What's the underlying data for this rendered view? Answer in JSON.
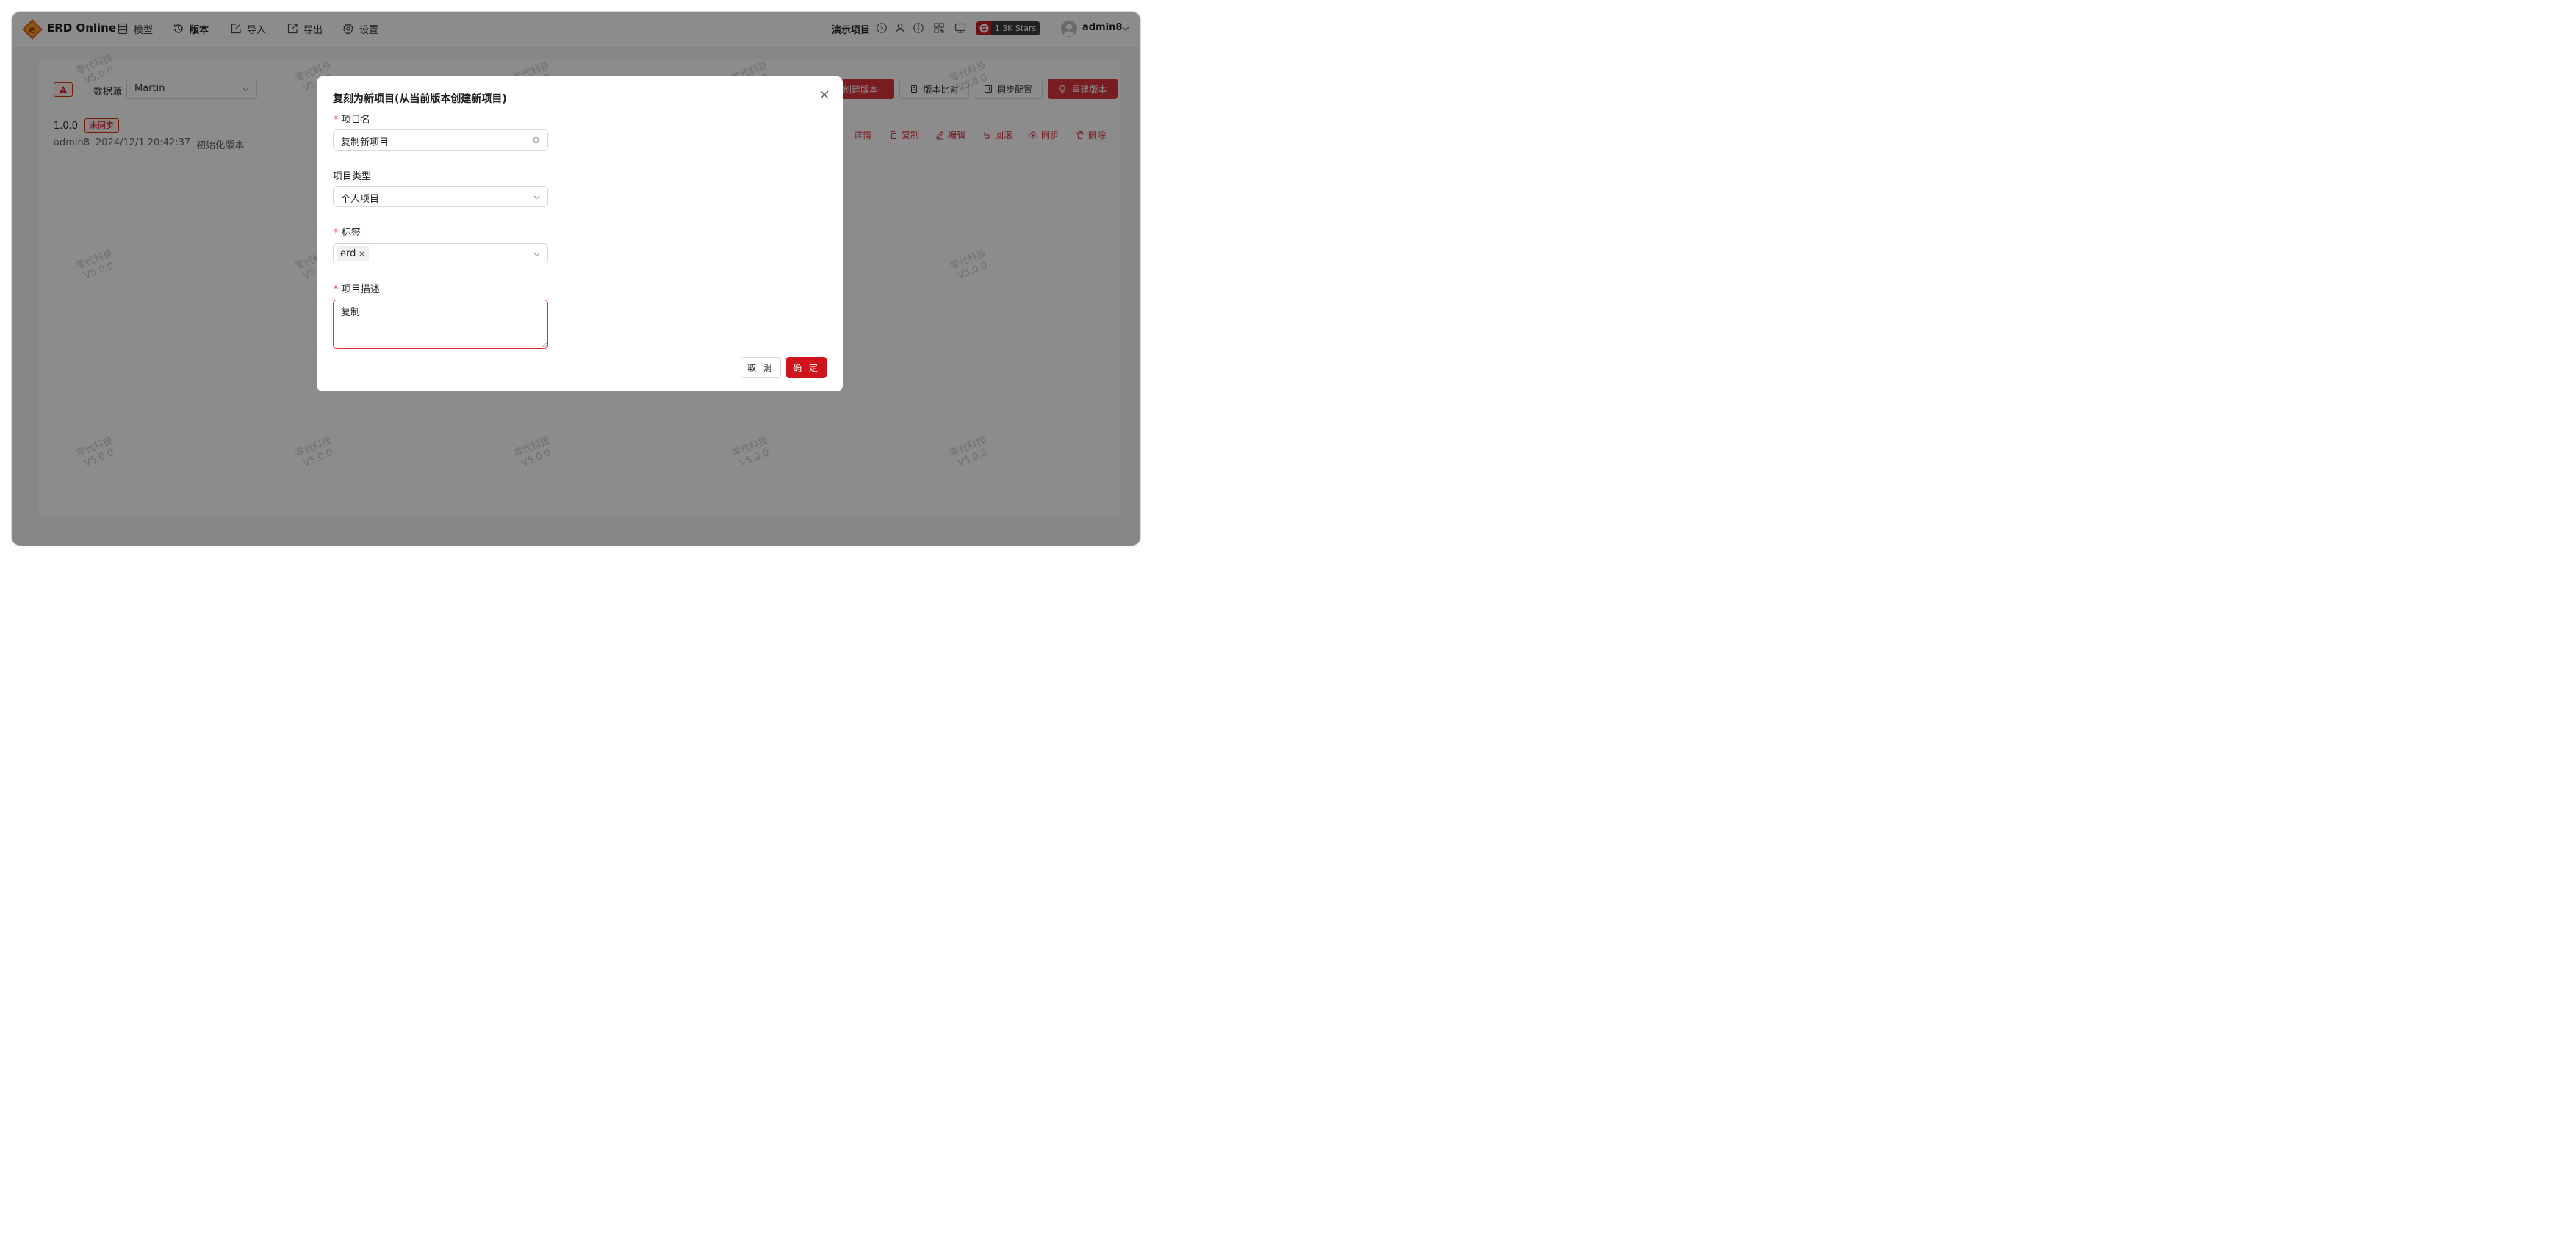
{
  "header": {
    "brand": "ERD Online",
    "nav": [
      {
        "label": "模型",
        "icon": "table-icon"
      },
      {
        "label": "版本",
        "icon": "history-icon"
      },
      {
        "label": "导入",
        "icon": "import-icon"
      },
      {
        "label": "导出",
        "icon": "export-icon"
      },
      {
        "label": "设置",
        "icon": "gear-icon"
      }
    ],
    "project_name": "演示项目",
    "stars": "1.3K Stars",
    "username": "admin8"
  },
  "page": {
    "datasource_label": "数据源",
    "datasource_value": "Martin",
    "version": "1.0.0",
    "sync_status": "未同步",
    "version_user": "admin8",
    "version_time": "2024/12/1 20:42:37",
    "version_desc": "初始化版本",
    "top_buttons": {
      "create_version": "创建版本",
      "compare": "版本比对",
      "sync_config": "同步配置",
      "rebuild": "重建版本"
    },
    "row_actions": {
      "detail": "详情",
      "copy": "复制",
      "edit": "编辑",
      "rollback": "回滚",
      "sync": "同步",
      "delete": "删除"
    }
  },
  "watermark": {
    "line1": "零代科技",
    "line2": "V5.0.0"
  },
  "modal": {
    "title": "复刻为新项目(从当前版本创建新项目)",
    "fields": {
      "name_label": "项目名",
      "name_value": "复制新项目",
      "type_label": "项目类型",
      "type_value": "个人项目",
      "tags_label": "标签",
      "tag_value": "erd",
      "desc_label": "项目描述",
      "desc_value": "复制"
    },
    "cancel": "取 消",
    "ok": "确 定"
  },
  "colors": {
    "primary": "#d0141b",
    "error_border": "#e22b2b",
    "overlay": "rgba(0,0,0,0.45)"
  }
}
